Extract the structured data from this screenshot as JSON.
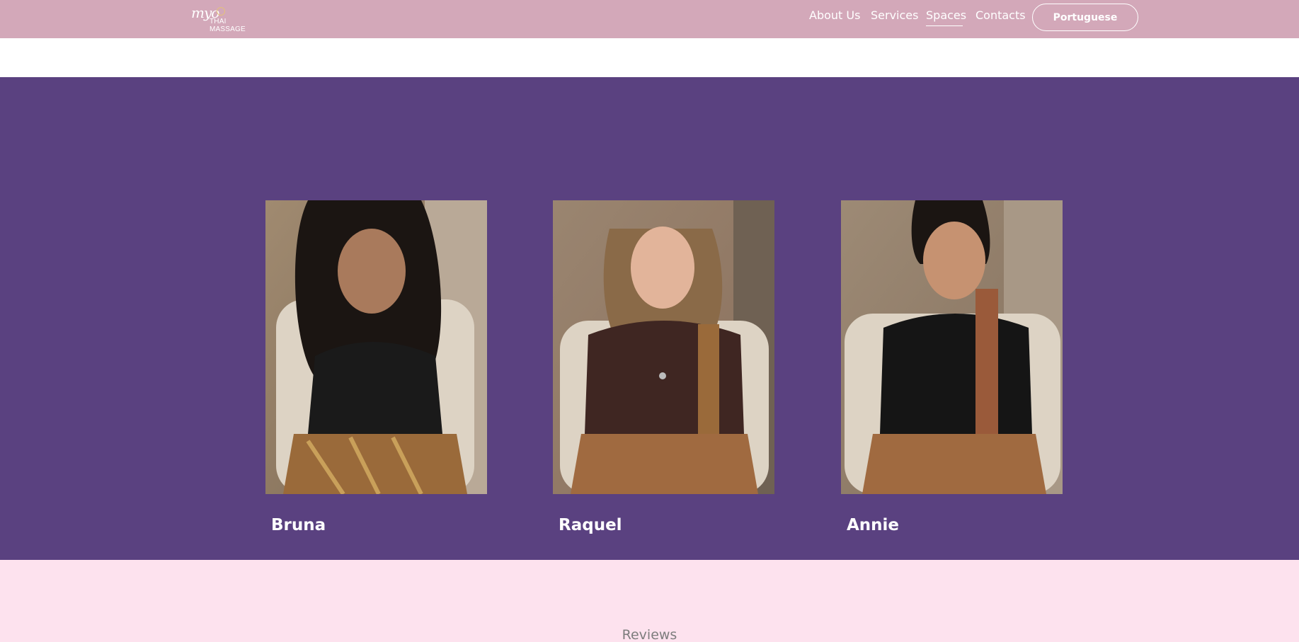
{
  "header": {
    "logo_script": "myo",
    "logo_sub": "THAI MASSAGE",
    "nav": [
      "About Us",
      "Services",
      "Spaces",
      "Contacts"
    ],
    "active_nav": "Spaces",
    "language_button": "Portuguese"
  },
  "team": {
    "members": [
      {
        "name": "Bruna",
        "top_color": "#1a1a1a"
      },
      {
        "name": "Raquel",
        "top_color": "#3f2622"
      },
      {
        "name": "Annie",
        "top_color": "#151515"
      }
    ]
  },
  "reviews": {
    "title": "Reviews"
  },
  "colors": {
    "header_bg": "#d3a8b9",
    "team_bg": "#5a4180",
    "reviews_bg": "#fde2ee"
  }
}
